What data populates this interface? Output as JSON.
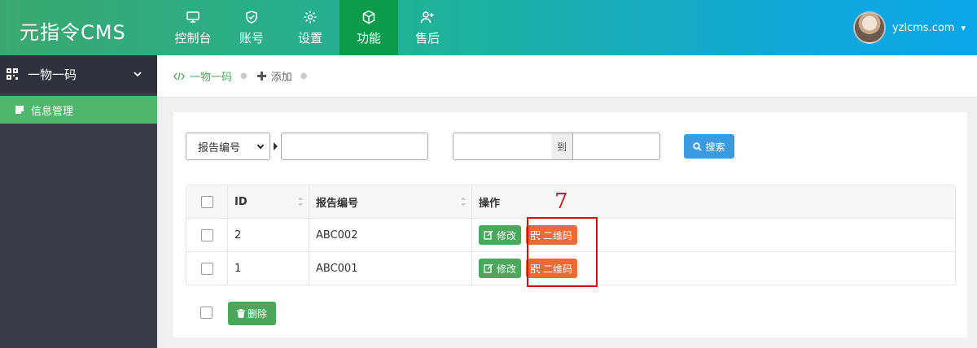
{
  "app": {
    "logo": "元指令CMS"
  },
  "nav": {
    "items": [
      {
        "label": "控制台",
        "icon": "monitor-icon"
      },
      {
        "label": "账号",
        "icon": "shield-icon"
      },
      {
        "label": "设置",
        "icon": "gear-icon"
      },
      {
        "label": "功能",
        "icon": "cube-icon",
        "active": true
      },
      {
        "label": "售后",
        "icon": "user-plus-icon"
      }
    ]
  },
  "user": {
    "name": "yzlcms.com"
  },
  "sidebar": {
    "group": {
      "label": "一物一码",
      "icon": "qr-icon"
    },
    "items": [
      {
        "label": "信息管理",
        "active": true
      }
    ]
  },
  "breadcrumb": [
    {
      "label": "一物一码",
      "icon": "code-icon"
    },
    {
      "label": "添加",
      "icon": "plus-icon"
    }
  ],
  "search": {
    "select_value": "报告编号",
    "keyword_value": "",
    "range_from_value": "",
    "range_to_label": "到",
    "range_to_value": "",
    "button_label": "搜索"
  },
  "table": {
    "headers": {
      "id": "ID",
      "report_no": "报告编号",
      "actions": "操作"
    },
    "rows": [
      {
        "id": "2",
        "report_no": "ABC002"
      },
      {
        "id": "1",
        "report_no": "ABC001"
      }
    ],
    "edit_label": "修改",
    "qr_label": "二维码"
  },
  "footer": {
    "delete_label": "删除"
  },
  "annotation": {
    "number": "7"
  },
  "colors": {
    "accent_green": "#4aa85b",
    "nav_active": "#0c9b4a",
    "qr_button": "#ee6a35",
    "search_button": "#3c9be0",
    "highlight": "#d60e0e"
  }
}
